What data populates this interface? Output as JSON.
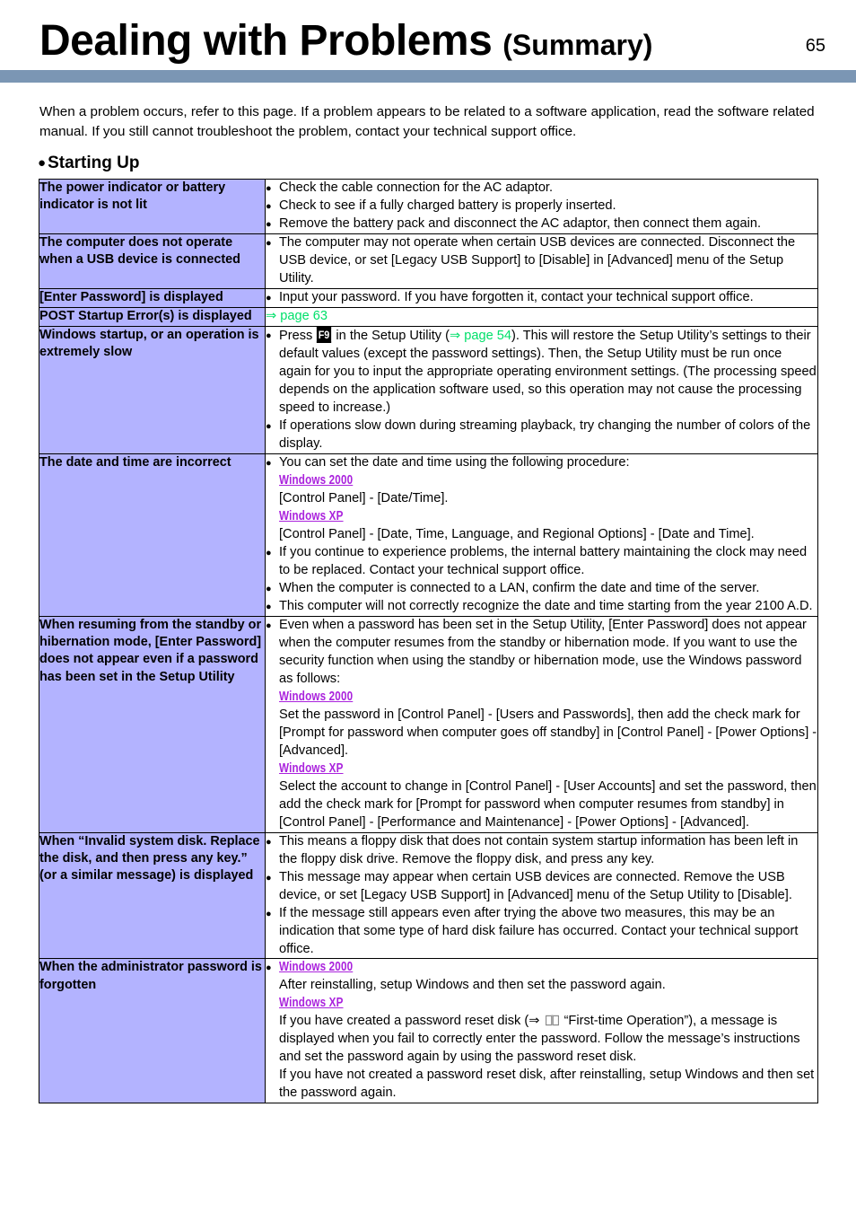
{
  "header": {
    "title_main": "Dealing with Problems",
    "title_sub": "(Summary)",
    "page_number": "65",
    "rule_color": "#7b96b4"
  },
  "intro": "When a problem occurs, refer to this page. If a problem appears to be related to a software application, read the software related manual. If you still cannot troubleshoot the problem, contact your technical support office.",
  "section": {
    "bullet": "●",
    "heading": "Starting Up"
  },
  "colors": {
    "symptom_cell_bg": "#b3b3ff",
    "link_green": "#00e06a",
    "windows_tag_purple": "#aa22dd",
    "header_rule": "#7b96b4"
  },
  "rows": [
    {
      "symptom": "The power indicator or battery indicator is not lit",
      "items": [
        {
          "text": "Check the cable connection for the AC adaptor."
        },
        {
          "text": "Check to see if a fully charged battery is properly inserted."
        },
        {
          "text": "Remove the battery pack and disconnect the AC adaptor, then connect them again."
        }
      ]
    },
    {
      "symptom": "The computer does not operate when a USB device is connected",
      "items": [
        {
          "text": "The computer may not operate when certain USB devices are connected.  Disconnect the USB device, or set [Legacy USB Support] to [Disable] in [Advanced] menu of the Setup Utility."
        }
      ]
    },
    {
      "symptom": "[Enter Password] is displayed",
      "items": [
        {
          "text": "Input your password. If you have forgotten it, contact your technical support office."
        }
      ]
    },
    {
      "symptom": "POST Startup Error(s) is displayed",
      "link_only": "⇒ page 63"
    },
    {
      "symptom": "Windows startup, or an operation is extremely slow",
      "items": [
        {
          "pre": "Press ",
          "keycap": "F9",
          "mid": " in the Setup Utility (",
          "link": "⇒ page 54",
          "post": "). This will restore the Setup Utility’s settings to their default values (except the password settings). Then, the Setup Utility must be run once again for you to input the appropriate operating environment settings. (The processing speed depends on the application software used, so this operation may not cause the processing speed to increase.)"
        },
        {
          "text": "If operations slow down during streaming playback, try changing the number of colors of the display."
        }
      ]
    },
    {
      "symptom": "The date and time are incorrect",
      "items": [
        {
          "text": "You can set the date and time using the following procedure:",
          "sublines": [
            {
              "tag": "Windows 2000"
            },
            {
              "line": "[Control Panel] - [Date/Time]."
            },
            {
              "tag": "Windows XP"
            },
            {
              "line": "[Control Panel] - [Date, Time, Language, and Regional Options] - [Date and Time]."
            }
          ]
        },
        {
          "text": "If you continue to experience problems, the internal battery maintaining the clock may need to be replaced.  Contact your technical support office."
        },
        {
          "text": "When the computer is connected to a LAN, confirm the date and time of the server."
        },
        {
          "text": "This computer will not correctly recognize the date and time starting from the year 2100 A.D."
        }
      ]
    },
    {
      "symptom": "When resuming from the standby or hibernation mode, [Enter Password] does not appear even if a password has been set in the Setup Utility",
      "items": [
        {
          "text": "Even when a password has been set in the Setup Utility, [Enter Password] does not appear when the computer resumes from the standby or hibernation mode. If you want to use the security function when using the standby or hibernation mode, use the Windows password as follows:",
          "sublines": [
            {
              "tag": "Windows 2000"
            },
            {
              "line": "Set the password in [Control Panel] - [Users and Passwords], then add the check mark for [Prompt for password when computer goes off standby] in [Control Panel] - [Power Options] - [Advanced]."
            },
            {
              "tag": "Windows XP"
            },
            {
              "line": "Select the account to change in [Control Panel] - [User Accounts] and set the password, then  add the check mark for [Prompt for password when computer resumes from standby] in [Control Panel] - [Performance and Maintenance] - [Power Options] - [Advanced]."
            }
          ]
        }
      ]
    },
    {
      "symptom": "When “Invalid system disk. Replace the disk, and then press any key.” (or a similar message) is displayed",
      "items": [
        {
          "text": "This means a floppy disk that does not contain system startup information has been left in the floppy disk drive.  Remove the floppy disk, and press any key."
        },
        {
          "text": "This message may appear when certain USB devices are connected.  Remove the USB device, or set [Legacy USB Support] in [Advanced] menu of the Setup Utility to [Disable]."
        },
        {
          "text": "If the message still appears even after trying the above two measures, this may be an indication that some type of hard disk failure has occurred. Contact your technical support office."
        }
      ]
    },
    {
      "symptom": "When the administrator password is forgotten",
      "items": [
        {
          "tag_first": "Windows 2000",
          "sublines": [
            {
              "line": "After reinstalling, setup Windows and then set the password again."
            },
            {
              "tag": "Windows XP"
            },
            {
              "line_book": {
                "pre": "If you have created a password reset disk (⇒ ",
                "post": " “First-time Operation”), a message is displayed when you fail to correctly enter the password. Follow the message’s instructions and set the password again by using the password reset disk."
              }
            },
            {
              "line": "If you have not created a password reset disk, after reinstalling, setup Windows and then set the password again."
            }
          ]
        }
      ]
    }
  ]
}
